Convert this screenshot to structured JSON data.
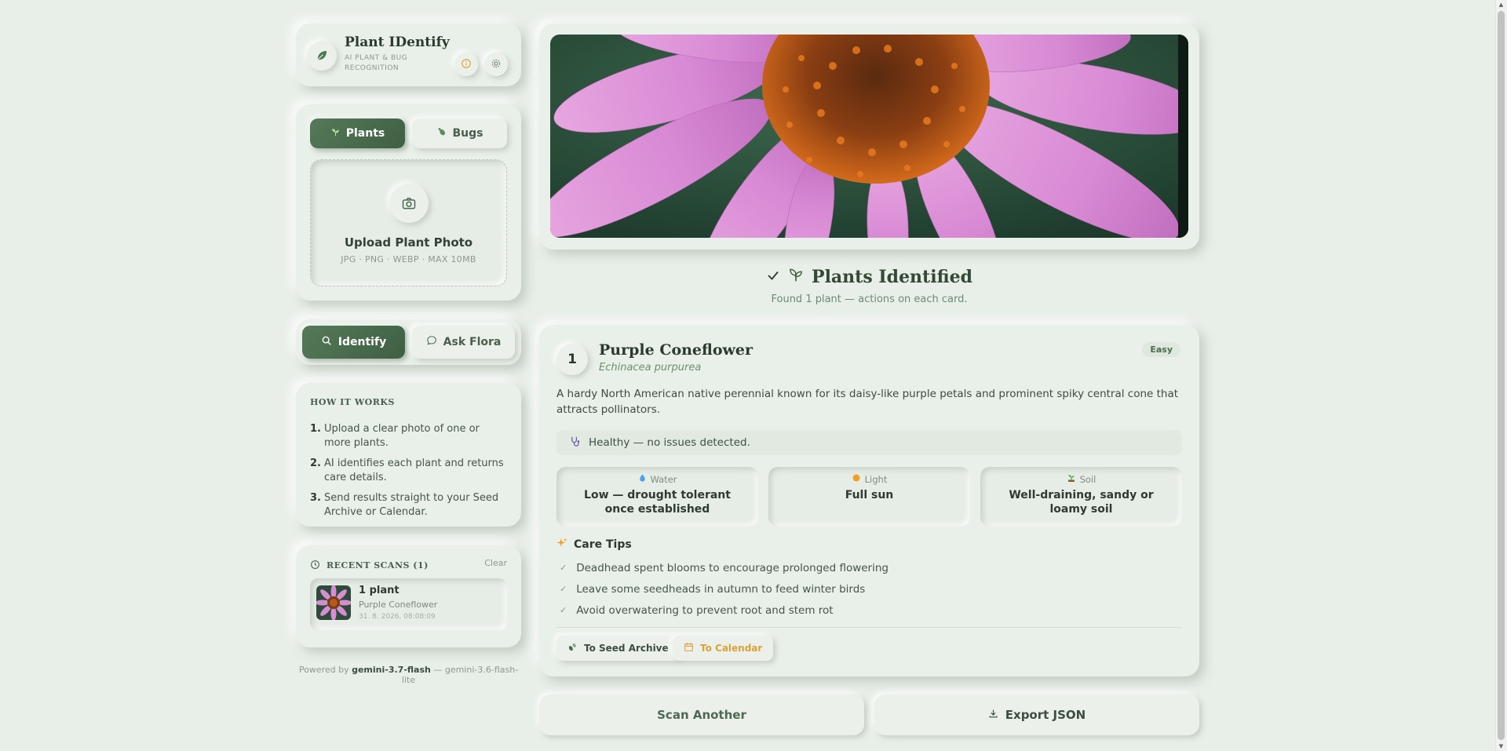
{
  "header": {
    "title": "Plant IDentify",
    "subtitle": "AI PLANT & BUG RECOGNITION"
  },
  "mode_tabs": [
    {
      "label": "Plants",
      "active": true
    },
    {
      "label": "Bugs",
      "active": false
    }
  ],
  "upload": {
    "title": "Upload Plant Photo",
    "formats": "JPG · PNG · WEBP · MAX 10MB"
  },
  "actions": {
    "identify_label": "Identify",
    "ask_label": "Ask Flora"
  },
  "how_it_works": {
    "heading": "HOW IT WORKS",
    "steps": [
      {
        "num": "1.",
        "text": "Upload a clear photo of one or more plants."
      },
      {
        "num": "2.",
        "text": "AI identifies each plant and returns care details."
      },
      {
        "num": "3.",
        "text": "Send results straight to your Seed Archive or Calendar."
      }
    ]
  },
  "recent_scans": {
    "heading": "RECENT SCANS (1)",
    "clear_label": "Clear",
    "items": [
      {
        "title": "1 plant",
        "name": "Purple Coneflower",
        "time": "31. 8. 2026, 08:08:09"
      }
    ]
  },
  "footer": {
    "prefix": "Powered by",
    "model": "gemini-3.7-flash",
    "suffix": "— gemini-3.6-flash-lite"
  },
  "results": {
    "title": "Plants Identified",
    "subtitle": "Found 1 plant — actions on each card."
  },
  "plant": {
    "index": "1",
    "name": "Purple Coneflower",
    "scientific": "Echinacea purpurea",
    "difficulty": "Easy",
    "description": "A hardy North American native perennial known for its daisy-like purple petals and prominent spiky central cone that attracts pollinators.",
    "health": "Healthy — no issues detected.",
    "stats": [
      {
        "label": "Water",
        "value": "Low — drought tolerant once established",
        "icon": "water-drop-icon"
      },
      {
        "label": "Light",
        "value": "Full sun",
        "icon": "sun-icon"
      },
      {
        "label": "Soil",
        "value": "Well-draining, sandy or loamy soil",
        "icon": "seedling-icon"
      }
    ],
    "care_tips_heading": "Care Tips",
    "care_tips": [
      "Deadhead spent blooms to encourage prolonged flowering",
      "Leave some seedheads in autumn to feed winter birds",
      "Avoid overwatering to prevent root and stem rot"
    ],
    "seed_archive_label": "To Seed Archive",
    "calendar_label": "To Calendar"
  },
  "bottom": {
    "scan_another_label": "Scan Another",
    "export_label": "Export JSON"
  },
  "colors": {
    "accent": "#4a6b4d",
    "background": "#e8eee8",
    "warning": "#d9a23a"
  }
}
